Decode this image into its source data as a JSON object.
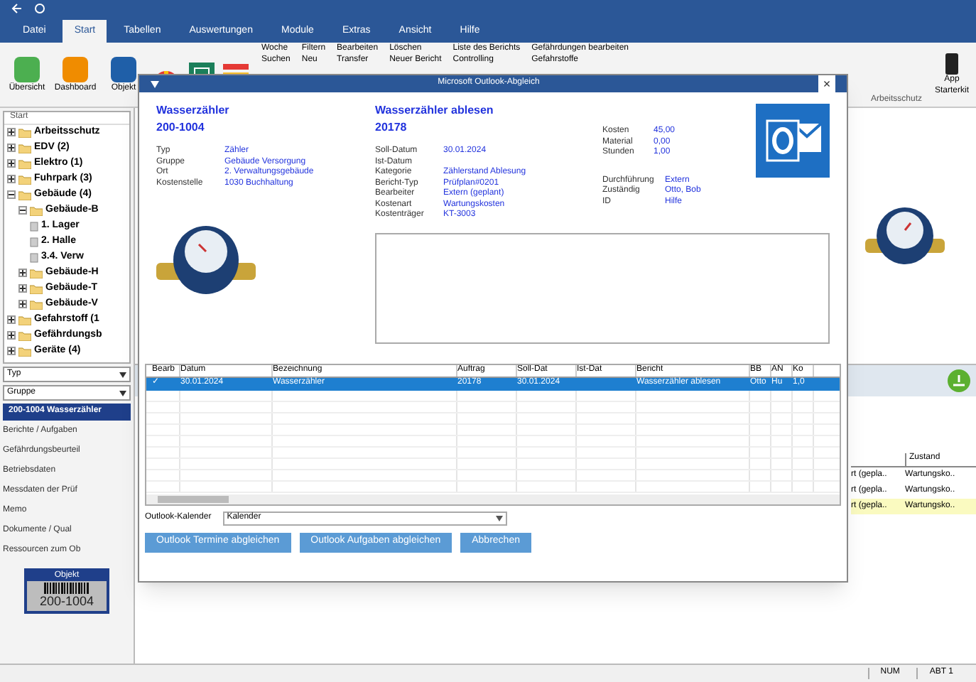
{
  "menu_tabs": [
    {
      "label": "Datei",
      "selected": false
    },
    {
      "label": "Start",
      "selected": true
    },
    {
      "label": "Tabellen",
      "selected": false
    },
    {
      "label": "Auswertungen",
      "selected": false
    },
    {
      "label": "Module",
      "selected": false
    },
    {
      "label": "Extras",
      "selected": false
    },
    {
      "label": "Ansicht",
      "selected": false
    },
    {
      "label": "Hilfe",
      "selected": false
    }
  ],
  "ribbon": {
    "large_buttons": [
      "Übersicht",
      "Dashboard",
      "Objekt"
    ],
    "small_buttons": [
      "Woche",
      "Suchen",
      "Filtern",
      "Neu",
      "Bearbeiten",
      "Transfer",
      "Löschen",
      "Neuer Bericht",
      "Liste des Berichts",
      "Controlling",
      "Gefährdungen bearbeiten",
      "Gefahrstoffe"
    ],
    "right_button": "App Starterkit",
    "group_label": "Arbeitsschutz"
  },
  "tree": {
    "header": "Start",
    "items": [
      {
        "label": "Arbeitsschutz",
        "expanded": false
      },
      {
        "label": "EDV (2)",
        "expanded": false
      },
      {
        "label": "Elektro (1)",
        "expanded": false
      },
      {
        "label": "Fuhrpark (3)",
        "expanded": false
      },
      {
        "label": "Gebäude (4)",
        "expanded": true,
        "children": [
          {
            "label": "Gebäude-B",
            "expanded": true,
            "children": [
              {
                "label": "1. Lager"
              },
              {
                "label": "2. Halle"
              },
              {
                "label": "3.4. Verw"
              }
            ]
          },
          {
            "label": "Gebäude-H",
            "expanded": false
          },
          {
            "label": "Gebäude-T",
            "expanded": false
          },
          {
            "label": "Gebäude-V",
            "expanded": false
          }
        ]
      },
      {
        "label": "Gefahrstoff (1",
        "expanded": false
      },
      {
        "label": "Gefährdungsb",
        "expanded": false
      },
      {
        "label": "Geräte (4)",
        "expanded": false
      }
    ]
  },
  "filters": [
    {
      "label": "Typ"
    },
    {
      "label": "Gruppe"
    }
  ],
  "object_title": "200-1004 Wasserzähler",
  "object_links": [
    "Berichte / Aufgaben",
    "Gefährdungsbeurteil",
    "Betriebsdaten",
    "Messdaten der Prüf",
    "Memo",
    "Dokumente / Qual",
    "Ressourcen zum Ob"
  ],
  "object_label": {
    "title": "Objekt",
    "number": "200-1004"
  },
  "background_table": {
    "header": "Zustand",
    "rows": [
      {
        "cells": [
          "rt (geplа..",
          "Wartungsko.."
        ],
        "highlighted": false
      },
      {
        "cells": [
          "rt (geplа..",
          "Wartungsko.."
        ],
        "highlighted": false
      },
      {
        "cells": [
          "rt (geplа..",
          "Wartungsko.."
        ],
        "highlighted": true
      }
    ]
  },
  "dialog": {
    "title": "Microsoft Outlook-Abgleich",
    "close": "×",
    "object": {
      "heading": "Wasserzähler",
      "number": "200-1004",
      "fields": [
        {
          "label": "Typ",
          "value": "Zähler"
        },
        {
          "label": "Gruppe",
          "value": "Gebäude Versorgung"
        },
        {
          "label": "Ort",
          "value": "2. Verwaltungsgebäude"
        },
        {
          "label": "Kostenstelle",
          "value": "1030 Buchhaltung"
        }
      ]
    },
    "task": {
      "heading": "Wasserzähler ablesen",
      "number": "20178",
      "fields": [
        {
          "label": "Soll-Datum",
          "value": "30.01.2024"
        },
        {
          "label": "Ist-Datum"
        },
        {
          "label": "Kategorie",
          "value": "Zählerstand Ablesung"
        },
        {
          "label": "Bericht-Typ",
          "value": "Prüfplan#0201"
        },
        {
          "label": "Bearbeiter",
          "value": "Extern (geplant)"
        },
        {
          "label": "Kostenart",
          "value": "Wartungskosten"
        },
        {
          "label": "Kostenträger",
          "value": "KT-3003"
        }
      ]
    },
    "costs": [
      {
        "label": "Kosten",
        "value": "45,00"
      },
      {
        "label": "Material",
        "value": "0,00"
      },
      {
        "label": "Stunden",
        "value": "1,00"
      }
    ],
    "people": [
      {
        "label": "Durchführung",
        "value": "Extern"
      },
      {
        "label": "Zuständig",
        "value": "Otto, Bob"
      },
      {
        "label": "ID",
        "value": "Hilfe"
      }
    ],
    "table": {
      "columns": [
        "Bearb",
        "Datum",
        "Bezeichnung",
        "Auftrag",
        "Soll-Dat",
        "Ist-Dat",
        "Bericht",
        "BB",
        "AN",
        "Ko"
      ],
      "rows": [
        {
          "cells": [
            "✓",
            "30.01.2024",
            "Wasserzähler",
            "20178",
            "30.01.2024",
            null,
            "Wasserzähler ablesen",
            "Otto",
            "Hu",
            "1,0"
          ],
          "selected": true
        }
      ]
    },
    "calendar_label": "Outlook-Kalender",
    "calendar_value": "Kalender",
    "buttons": [
      "Outlook Termine abgleichen",
      "Outlook Aufgaben abgleichen",
      "Abbrechen"
    ]
  },
  "status_bar": [
    "NUM",
    "ABT 1"
  ]
}
